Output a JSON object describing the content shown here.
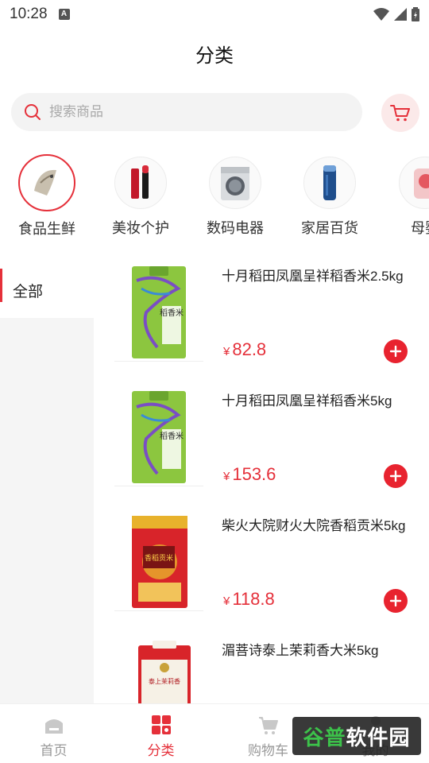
{
  "status": {
    "time": "10:28",
    "notif_glyph": "A"
  },
  "header": {
    "title": "分类"
  },
  "search": {
    "placeholder": "搜索商品",
    "icon": "search-icon"
  },
  "top_categories": [
    {
      "label": "食品生鲜",
      "active": true,
      "icon": "fish-icon"
    },
    {
      "label": "美妆个护",
      "active": false,
      "icon": "lipstick-icon"
    },
    {
      "label": "数码电器",
      "active": false,
      "icon": "washing-machine-icon"
    },
    {
      "label": "家居百货",
      "active": false,
      "icon": "thermos-icon"
    },
    {
      "label": "母婴",
      "active": false,
      "icon": "baby-icon"
    }
  ],
  "sidebar": {
    "items": [
      {
        "label": "全部",
        "active": true
      }
    ]
  },
  "products": [
    {
      "name": "十月稻田凤凰呈祥稻香米2.5kg",
      "currency": "¥",
      "price": "82.8",
      "pkg_text": "稻香米"
    },
    {
      "name": "十月稻田凤凰呈祥稻香米5kg",
      "currency": "¥",
      "price": "153.6",
      "pkg_text": "稻香米"
    },
    {
      "name": "柴火大院财火大院香稻贡米5kg",
      "currency": "¥",
      "price": "118.8",
      "pkg_text": "香稻贡米"
    },
    {
      "name": "湄菩诗泰上茉莉香大米5kg",
      "currency": "¥",
      "price": "",
      "pkg_text": "泰上茉莉香"
    }
  ],
  "bottom_nav": [
    {
      "label": "首页",
      "active": false,
      "icon": "home-icon"
    },
    {
      "label": "分类",
      "active": true,
      "icon": "category-icon"
    },
    {
      "label": "购物车",
      "active": false,
      "icon": "cart-icon"
    },
    {
      "label": "我的",
      "active": false,
      "icon": "user-icon"
    }
  ],
  "watermark": {
    "prefix": "谷普",
    "suffix": "软件园"
  },
  "colors": {
    "accent": "#e5303a",
    "rice_green": "#8cc63f",
    "rice_red": "#d8242a"
  }
}
